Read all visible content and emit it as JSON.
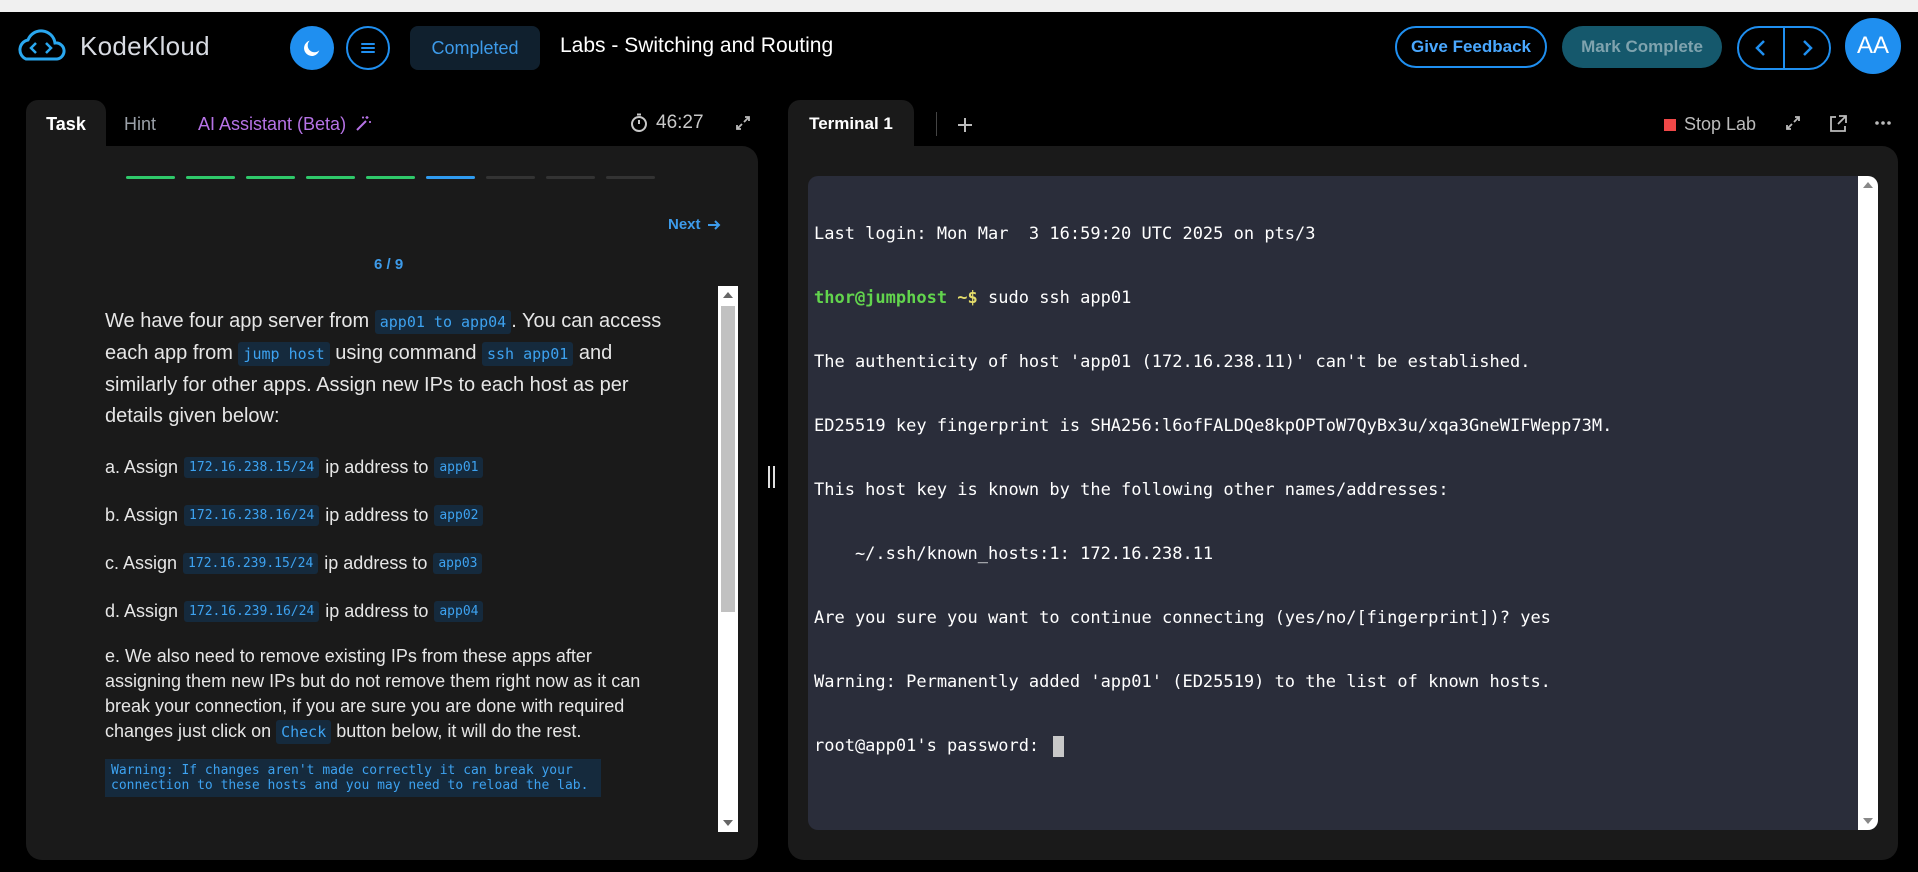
{
  "header": {
    "logo_text": "KodeKloud",
    "status_badge": "Completed",
    "title": "Labs - Switching and Routing",
    "give_feedback": "Give Feedback",
    "mark_complete": "Mark Complete",
    "avatar_initials": "AA"
  },
  "left": {
    "tabs": {
      "task": "Task",
      "hint": "Hint",
      "ai": "AI Assistant (Beta)"
    },
    "timer": "46:27",
    "progress": {
      "total": 9,
      "completed": 5,
      "current": 6,
      "colors": {
        "done": "#2fc96a",
        "current": "#2f9bf0",
        "todo": "#333333"
      }
    },
    "next_label": "Next",
    "step": "6 / 9",
    "intro": {
      "t1": "We have four app server from ",
      "c1": "app01 to app04",
      "t2": ". You can access each app from ",
      "c2": "jump host",
      "t3": " using command ",
      "c3": "ssh app01",
      "t4": " and similarly for other apps. Assign new IPs to each host as per details given below:"
    },
    "assign": [
      {
        "prefix": "a. Assign",
        "ip": "172.16.238.15/24",
        "mid": "ip address to",
        "host": "app01"
      },
      {
        "prefix": "b. Assign",
        "ip": "172.16.238.16/24",
        "mid": "ip address to",
        "host": "app02"
      },
      {
        "prefix": "c. Assign",
        "ip": "172.16.239.15/24",
        "mid": "ip address to",
        "host": "app03"
      },
      {
        "prefix": "d. Assign",
        "ip": "172.16.239.16/24",
        "mid": "ip address to",
        "host": "app04"
      }
    ],
    "note": {
      "t1": "e. We also need to remove existing IPs from these apps after assigning them new IPs but do not remove them right now as it can break your connection, if you are sure you are done with required changes just click on ",
      "code": "Check",
      "t2": " button below, it will do the rest."
    },
    "warning": "Warning: If changes aren't made correctly it can break your connection to these hosts and you may need to reload the lab."
  },
  "right": {
    "tab": "Terminal 1",
    "stop_lab": "Stop Lab",
    "terminal": {
      "l1": "Last login: Mon Mar  3 16:59:20 UTC 2025 on pts/3",
      "prompt_user": "thor@jumphost",
      "prompt_path": " ~$",
      "cmd": " sudo ssh app01",
      "l3": "The authenticity of host 'app01 (172.16.238.11)' can't be established.",
      "l4": "ED25519 key fingerprint is SHA256:l6ofFALDQe8kpOPToW7QyBx3u/xqa3GneWIFWepp73M.",
      "l5": "This host key is known by the following other names/addresses:",
      "l6": "    ~/.ssh/known_hosts:1: 172.16.238.11",
      "l7": "Are you sure you want to continue connecting (yes/no/[fingerprint])? yes",
      "l8": "Warning: Permanently added 'app01' (ED25519) to the list of known hosts.",
      "l9": "root@app01's password: "
    }
  }
}
